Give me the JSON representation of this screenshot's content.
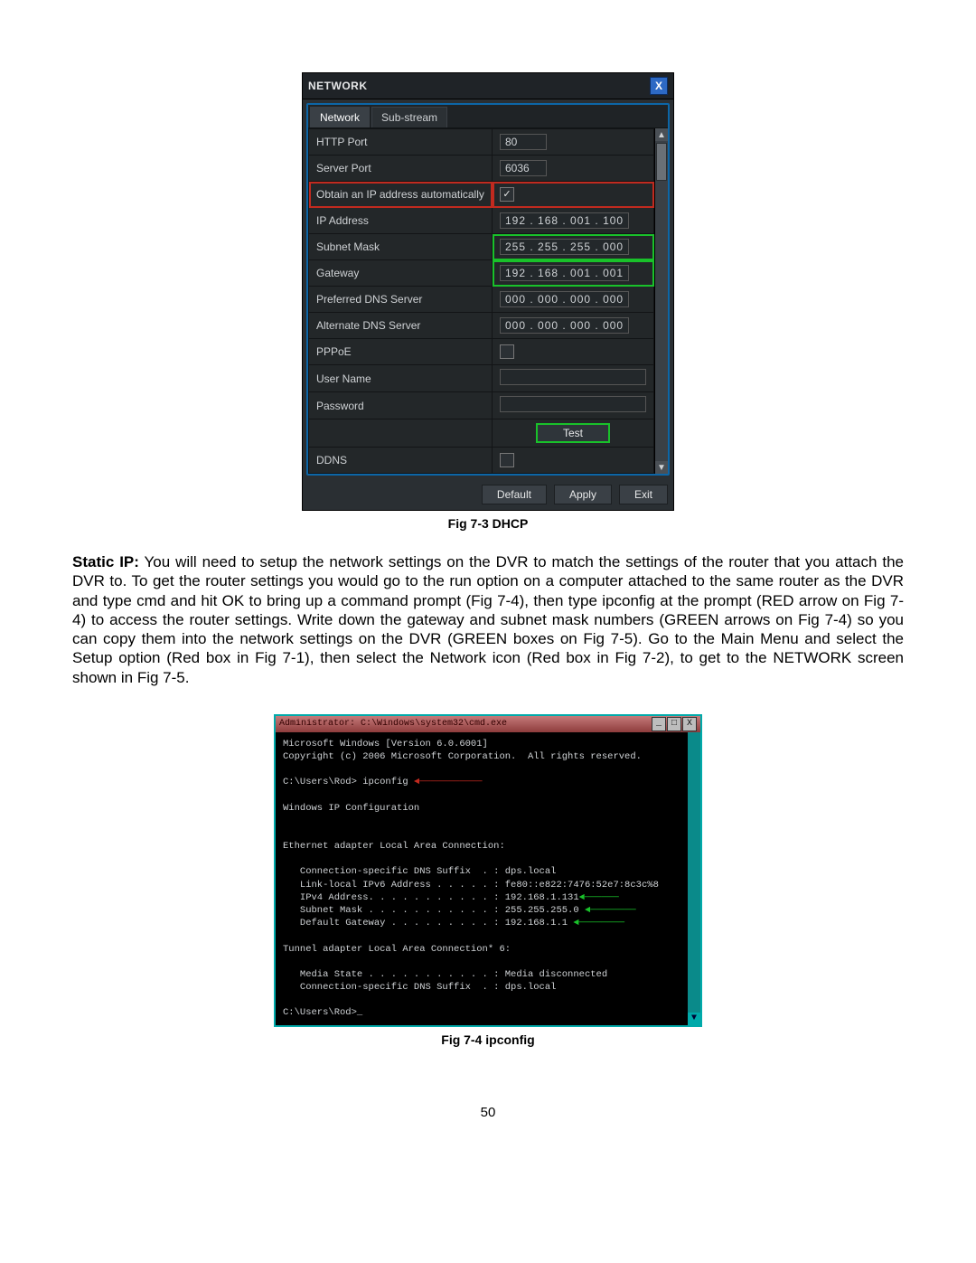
{
  "figure1": {
    "caption": "Fig 7-3 DHCP",
    "dialog": {
      "title": "NETWORK",
      "close": "X",
      "tabs": [
        "Network",
        "Sub-stream"
      ],
      "rows": {
        "http_port_label": "HTTP Port",
        "http_port_value": "80",
        "server_port_label": "Server Port",
        "server_port_value": "6036",
        "dhcp_label": "Obtain an IP address automatically",
        "dhcp_mark": "✓",
        "ip_label": "IP Address",
        "ip_value": "192 . 168 . 001 . 100",
        "subnet_label": "Subnet Mask",
        "subnet_value": "255 . 255 . 255 . 000",
        "gateway_label": "Gateway",
        "gateway_value": "192 . 168 . 001 . 001",
        "pdns_label": "Preferred DNS Server",
        "pdns_value": "000 . 000 . 000 . 000",
        "adns_label": "Alternate DNS Server",
        "adns_value": "000 . 000 . 000 . 000",
        "pppoe_label": "PPPoE",
        "user_label": "User Name",
        "pass_label": "Password",
        "test_label": "Test",
        "ddns_label": "DDNS"
      },
      "footer": {
        "default": "Default",
        "apply": "Apply",
        "exit": "Exit"
      },
      "scroll": {
        "up": "▲",
        "down": "▼"
      }
    }
  },
  "paragraph": {
    "label": "Static IP:",
    "text": " You will need to setup the network settings on the DVR to match the settings of the router that you attach the DVR to. To get the router settings you would go to the run option on a computer attached to the same router as the DVR and type cmd and hit OK to bring up a command prompt (Fig 7-4), then type ipconfig at the prompt (RED arrow on Fig 7-4) to access the router settings. Write down the gateway and subnet mask numbers (GREEN arrows on Fig 7-4) so you can copy them into the network settings on the DVR (GREEN boxes on Fig 7-5). Go to the Main Menu and select the Setup option (Red box in Fig 7-1), then select the Network icon (Red box in Fig 7-2), to get to the NETWORK screen shown in Fig 7-5."
  },
  "figure2": {
    "caption": "Fig 7-4 ipconfig",
    "cmd": {
      "title": "Administrator: C:\\Windows\\system32\\cmd.exe",
      "lines": {
        "l1": "Microsoft Windows [Version 6.0.6001]",
        "l2": "Copyright (c) 2006 Microsoft Corporation.  All rights reserved.",
        "l3": "",
        "l4": "C:\\Users\\Rod> ipconfig ",
        "l4arrow": "◄───────────",
        "l5": "",
        "l6": "Windows IP Configuration",
        "l7": "",
        "l8": "",
        "l9": "Ethernet adapter Local Area Connection:",
        "l10": "",
        "l11": "   Connection-specific DNS Suffix  . : dps.local",
        "l12": "   Link-local IPv6 Address . . . . . : fe80::e822:7476:52e7:8c3c%8",
        "l13": "   IPv4 Address. . . . . . . . . . . : 192.168.1.131",
        "l13arrow": "◄──────",
        "l14": "   Subnet Mask . . . . . . . . . . . : 255.255.255.0 ",
        "l14arrow": "◄────────",
        "l15": "   Default Gateway . . . . . . . . . : 192.168.1.1 ",
        "l15arrow": "◄────────",
        "l16": "",
        "l17": "Tunnel adapter Local Area Connection* 6:",
        "l18": "",
        "l19": "   Media State . . . . . . . . . . . : Media disconnected",
        "l20": "   Connection-specific DNS Suffix  . : dps.local",
        "l21": "",
        "l22": "C:\\Users\\Rod>_"
      },
      "ctrls": {
        "min": "_",
        "max": "□",
        "close": "X"
      },
      "scroll": {
        "down": "▼"
      }
    }
  },
  "page_num": "50"
}
